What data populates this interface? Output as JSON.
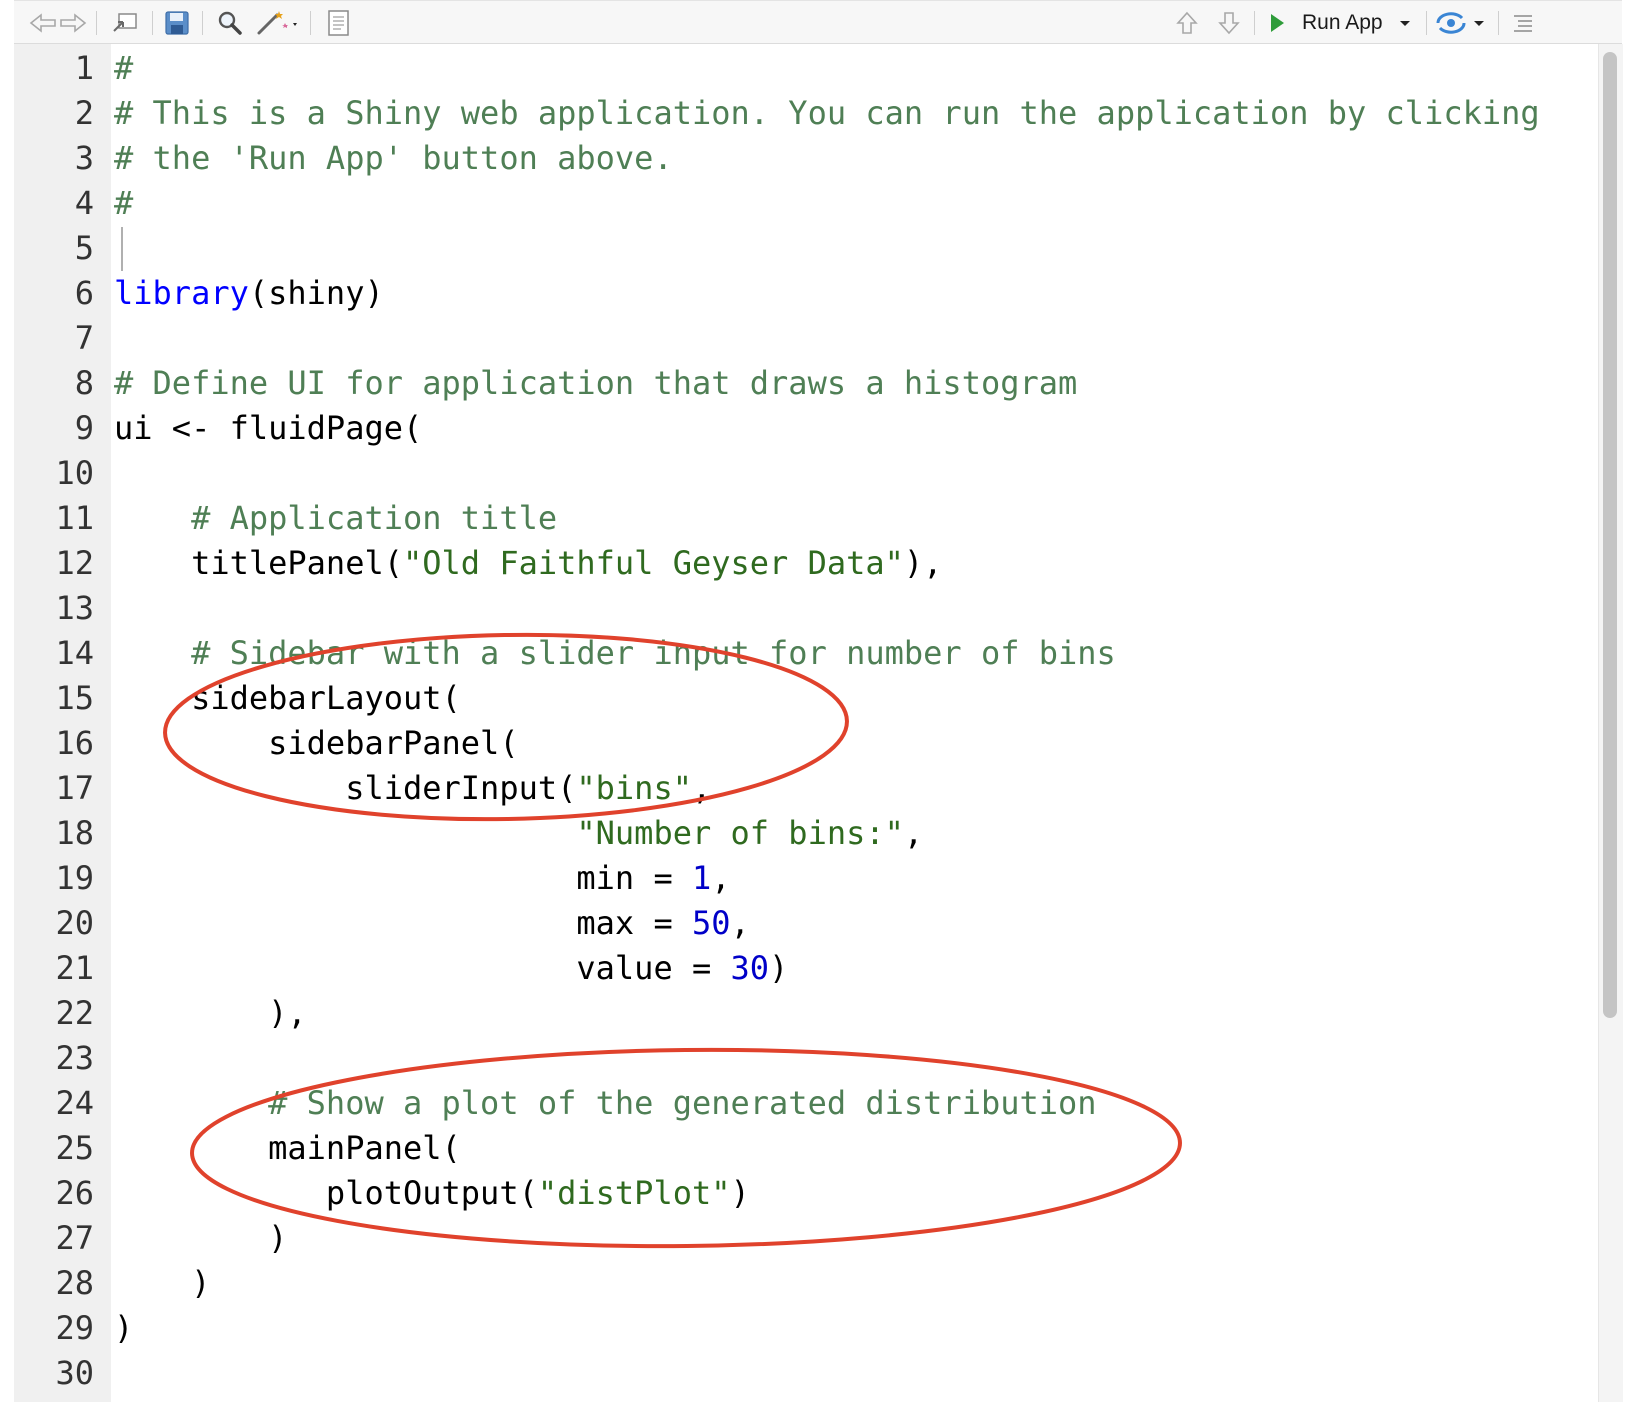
{
  "toolbar": {
    "run_label": "Run App",
    "icons": [
      "back-icon",
      "forward-icon",
      "show-in-window-icon",
      "save-icon",
      "search-icon",
      "magic-wand-icon",
      "compile-report-icon",
      "go-up-icon",
      "go-down-icon",
      "run-icon",
      "publish-icon",
      "outline-icon"
    ]
  },
  "colors": {
    "comment": "#4f7f55",
    "keyword": "#0000ff",
    "string": "#2f6a1f",
    "number": "#0000c8",
    "plain": "#000000",
    "annotation": "#e0422c"
  },
  "lines": [
    {
      "num": "1",
      "tokens": [
        {
          "t": "#",
          "c": "comment"
        }
      ]
    },
    {
      "num": "2",
      "tokens": [
        {
          "t": "# This is a Shiny web application. You can run the application by clicking",
          "c": "comment"
        }
      ]
    },
    {
      "num": "3",
      "tokens": [
        {
          "t": "# the 'Run App' button above.",
          "c": "comment"
        }
      ]
    },
    {
      "num": "4",
      "tokens": [
        {
          "t": "#",
          "c": "comment"
        }
      ]
    },
    {
      "num": "5",
      "tokens": []
    },
    {
      "num": "6",
      "tokens": [
        {
          "t": "library",
          "c": "keyword"
        },
        {
          "t": "(shiny)",
          "c": "plain"
        }
      ]
    },
    {
      "num": "7",
      "tokens": []
    },
    {
      "num": "8",
      "tokens": [
        {
          "t": "# Define UI for application that draws a histogram",
          "c": "comment"
        }
      ]
    },
    {
      "num": "9",
      "tokens": [
        {
          "t": "ui <- fluidPage(",
          "c": "plain"
        }
      ]
    },
    {
      "num": "10",
      "tokens": []
    },
    {
      "num": "11",
      "tokens": [
        {
          "t": "    ",
          "c": "plain"
        },
        {
          "t": "# Application title",
          "c": "comment"
        }
      ]
    },
    {
      "num": "12",
      "tokens": [
        {
          "t": "    titlePanel(",
          "c": "plain"
        },
        {
          "t": "\"Old Faithful Geyser Data\"",
          "c": "string"
        },
        {
          "t": "),",
          "c": "plain"
        }
      ]
    },
    {
      "num": "13",
      "tokens": []
    },
    {
      "num": "14",
      "tokens": [
        {
          "t": "    ",
          "c": "plain"
        },
        {
          "t": "# Sidebar with a slider input for number of bins",
          "c": "comment"
        }
      ]
    },
    {
      "num": "15",
      "tokens": [
        {
          "t": "    sidebarLayout(",
          "c": "plain"
        }
      ]
    },
    {
      "num": "16",
      "tokens": [
        {
          "t": "        sidebarPanel(",
          "c": "plain"
        }
      ]
    },
    {
      "num": "17",
      "tokens": [
        {
          "t": "            sliderInput(",
          "c": "plain"
        },
        {
          "t": "\"bins\"",
          "c": "string"
        },
        {
          "t": ",",
          "c": "plain"
        }
      ]
    },
    {
      "num": "18",
      "tokens": [
        {
          "t": "                        ",
          "c": "plain"
        },
        {
          "t": "\"Number of bins:\"",
          "c": "string"
        },
        {
          "t": ",",
          "c": "plain"
        }
      ]
    },
    {
      "num": "19",
      "tokens": [
        {
          "t": "                        min = ",
          "c": "plain"
        },
        {
          "t": "1",
          "c": "number"
        },
        {
          "t": ",",
          "c": "plain"
        }
      ]
    },
    {
      "num": "20",
      "tokens": [
        {
          "t": "                        max = ",
          "c": "plain"
        },
        {
          "t": "50",
          "c": "number"
        },
        {
          "t": ",",
          "c": "plain"
        }
      ]
    },
    {
      "num": "21",
      "tokens": [
        {
          "t": "                        value = ",
          "c": "plain"
        },
        {
          "t": "30",
          "c": "number"
        },
        {
          "t": ")",
          "c": "plain"
        }
      ]
    },
    {
      "num": "22",
      "tokens": [
        {
          "t": "        ),",
          "c": "plain"
        }
      ]
    },
    {
      "num": "23",
      "tokens": []
    },
    {
      "num": "24",
      "tokens": [
        {
          "t": "        ",
          "c": "plain"
        },
        {
          "t": "# Show a plot of the generated distribution",
          "c": "comment"
        }
      ]
    },
    {
      "num": "25",
      "tokens": [
        {
          "t": "        mainPanel(",
          "c": "plain"
        }
      ]
    },
    {
      "num": "26",
      "tokens": [
        {
          "t": "           plotOutput(",
          "c": "plain"
        },
        {
          "t": "\"distPlot\"",
          "c": "string"
        },
        {
          "t": ")",
          "c": "plain"
        }
      ]
    },
    {
      "num": "27",
      "tokens": [
        {
          "t": "        )",
          "c": "plain"
        }
      ]
    },
    {
      "num": "28",
      "tokens": [
        {
          "t": "    )",
          "c": "plain"
        }
      ]
    },
    {
      "num": "29",
      "tokens": [
        {
          "t": ")",
          "c": "plain"
        }
      ]
    },
    {
      "num": "30",
      "tokens": []
    }
  ]
}
